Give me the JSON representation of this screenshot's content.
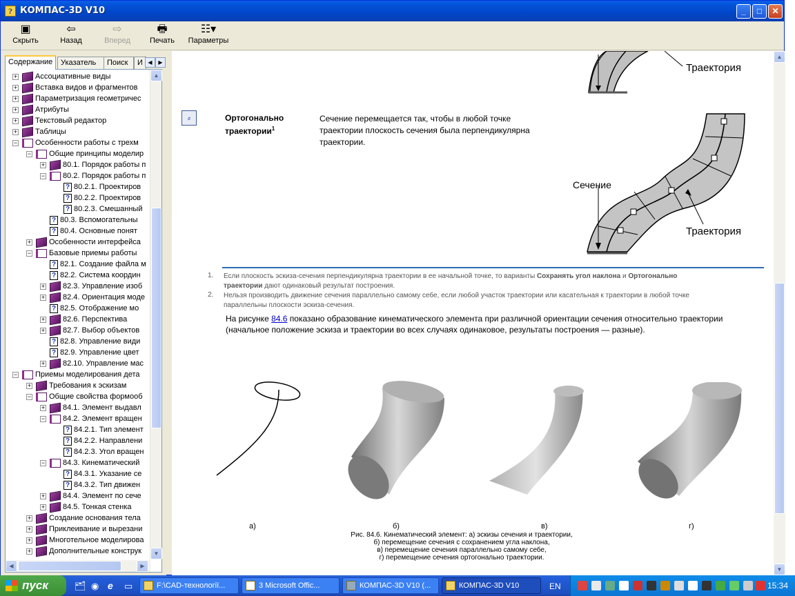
{
  "window": {
    "title": "КОМПАС-3D V10"
  },
  "toolbar": [
    {
      "label": "Скрыть",
      "icon": "hide-icon",
      "enabled": true
    },
    {
      "label": "Назад",
      "icon": "back-arrow-icon",
      "enabled": true
    },
    {
      "label": "Вперед",
      "icon": "forward-arrow-icon",
      "enabled": false
    },
    {
      "label": "Печать",
      "icon": "printer-icon",
      "enabled": true
    },
    {
      "label": "Параметры",
      "icon": "options-icon",
      "enabled": true
    }
  ],
  "tabs": [
    "Содержание",
    "Указатель",
    "Поиск",
    "И"
  ],
  "tree": [
    {
      "label": "Ассоциативные виды",
      "level": 0,
      "type": "book",
      "pm": "+"
    },
    {
      "label": "Вставка видов и фрагментов",
      "level": 0,
      "type": "book",
      "pm": "+"
    },
    {
      "label": "Параметризация геометричес",
      "level": 0,
      "type": "book",
      "pm": "+"
    },
    {
      "label": "Атрибуты",
      "level": 0,
      "type": "book",
      "pm": "+"
    },
    {
      "label": "Текстовый редактор",
      "level": 0,
      "type": "book",
      "pm": "+"
    },
    {
      "label": "Таблицы",
      "level": 0,
      "type": "book",
      "pm": "+"
    },
    {
      "label": "Особенности работы с трехм",
      "level": 0,
      "type": "open",
      "pm": "-"
    },
    {
      "label": "Общие принципы моделир",
      "level": 1,
      "type": "open",
      "pm": "-"
    },
    {
      "label": "80.1. Порядок работы п",
      "level": 2,
      "type": "book",
      "pm": "+"
    },
    {
      "label": "80.2. Порядок работы п",
      "level": 2,
      "type": "open",
      "pm": "-"
    },
    {
      "label": "80.2.1. Проектиров",
      "level": 3,
      "type": "page",
      "pm": ""
    },
    {
      "label": "80.2.2. Проектиров",
      "level": 3,
      "type": "page",
      "pm": ""
    },
    {
      "label": "80.2.3. Смешанный",
      "level": 3,
      "type": "page",
      "pm": ""
    },
    {
      "label": "80.3. Вспомогательны",
      "level": 2,
      "type": "page",
      "pm": ""
    },
    {
      "label": "80.4. Основные понят",
      "level": 2,
      "type": "page",
      "pm": ""
    },
    {
      "label": "Особенности интерфейса",
      "level": 1,
      "type": "book",
      "pm": "+"
    },
    {
      "label": "Базовые приемы работы",
      "level": 1,
      "type": "open",
      "pm": "-"
    },
    {
      "label": "82.1. Создание файла м",
      "level": 2,
      "type": "page",
      "pm": ""
    },
    {
      "label": "82.2. Система координ",
      "level": 2,
      "type": "page",
      "pm": ""
    },
    {
      "label": "82.3. Управление изоб",
      "level": 2,
      "type": "book",
      "pm": "+"
    },
    {
      "label": "82.4. Ориентация моде",
      "level": 2,
      "type": "book",
      "pm": "+"
    },
    {
      "label": "82.5. Отображение мо",
      "level": 2,
      "type": "page",
      "pm": ""
    },
    {
      "label": "82.6. Перспектива",
      "level": 2,
      "type": "book",
      "pm": "+"
    },
    {
      "label": "82.7. Выбор объектов",
      "level": 2,
      "type": "book",
      "pm": "+"
    },
    {
      "label": "82.8. Управление види",
      "level": 2,
      "type": "page",
      "pm": ""
    },
    {
      "label": "82.9. Управление цвет",
      "level": 2,
      "type": "page",
      "pm": ""
    },
    {
      "label": "82.10. Управление мас",
      "level": 2,
      "type": "book",
      "pm": "+"
    },
    {
      "label": "Приемы моделирования дета",
      "level": 0,
      "type": "open",
      "pm": "-"
    },
    {
      "label": "Требования к эскизам",
      "level": 1,
      "type": "book",
      "pm": "+"
    },
    {
      "label": "Общие свойства формооб",
      "level": 1,
      "type": "open",
      "pm": "-"
    },
    {
      "label": "84.1. Элемент выдавл",
      "level": 2,
      "type": "book",
      "pm": "+"
    },
    {
      "label": "84.2. Элемент вращен",
      "level": 2,
      "type": "open",
      "pm": "-"
    },
    {
      "label": "84.2.1. Тип элемент",
      "level": 3,
      "type": "page",
      "pm": ""
    },
    {
      "label": "84.2.2. Направлени",
      "level": 3,
      "type": "page",
      "pm": ""
    },
    {
      "label": "84.2.3. Угол вращен",
      "level": 3,
      "type": "page",
      "pm": ""
    },
    {
      "label": "84.3. Кинематический",
      "level": 2,
      "type": "open",
      "pm": "-"
    },
    {
      "label": "84.3.1. Указание се",
      "level": 3,
      "type": "page",
      "pm": ""
    },
    {
      "label": "84.3.2. Тип движен",
      "level": 3,
      "type": "page",
      "pm": ""
    },
    {
      "label": "84.4. Элемент по сече",
      "level": 2,
      "type": "book",
      "pm": "+"
    },
    {
      "label": "84.5. Тонкая стенка",
      "level": 2,
      "type": "book",
      "pm": "+"
    },
    {
      "label": "Создание основания тела",
      "level": 1,
      "type": "book",
      "pm": "+"
    },
    {
      "label": "Приклеивание и вырезани",
      "level": 1,
      "type": "book",
      "pm": "+"
    },
    {
      "label": "Многотельное моделирова",
      "level": 1,
      "type": "book",
      "pm": "+"
    },
    {
      "label": "Дополнительные конструк",
      "level": 1,
      "type": "book",
      "pm": "+"
    }
  ],
  "content": {
    "top_label": "Траектория",
    "option_title": "Ортогонально траектории",
    "option_title_line1": "Ортогонально",
    "option_title_line2": "траектории",
    "footnote_mark": "1",
    "option_desc_line1": "Сечение перемещается так, чтобы в любой точке",
    "option_desc_line2": "траектории плоскость сечения была перпендикулярна",
    "option_desc_line3": "траектории.",
    "label_section": "Сечение",
    "label_trajectory": "Траектория",
    "notes": [
      {
        "num": "1.",
        "line1_pre": "Если плоскость эскиза-сечения перпендикулярна траектории в ее начальной точке, то варианты ",
        "bold1": "Сохранять угол наклона",
        "mid": " и ",
        "bold2": "Ортогонально",
        "line2_bold": "траектории",
        "line2_rest": " дают одинаковый результат построения."
      },
      {
        "num": "2.",
        "line1": "Нельзя производить движение сечения параллельно самому себе, если любой участок траектории или касательная к траектории в любой точке",
        "line2": "параллельны плоскости эскиза-сечения."
      }
    ],
    "para_pre": "На рисунке ",
    "para_link": "84.6",
    "para_post": " показано образование кинематического элемента при различной ориентации сечения относительно траектории",
    "para_line2": "(начальное положение эскиза и траектории во всех случаях одинаковое, результаты построения — разные).",
    "figure_labels": [
      "а)",
      "б)",
      "в)",
      "г)"
    ],
    "caption": [
      "Рис. 84.6. Кинематический элемент: а) эскизы сечения и траектории,",
      "б) перемещение сечения с сохранением угла наклона,",
      "в) перемещение сечения параллельно самому себе,",
      "г) перемещение сечения ортогонально траектории."
    ]
  },
  "taskbar": {
    "start": "пуск",
    "tasks": [
      "F:\\CAD-технології...",
      "3 Microsoft Offic...",
      "КОМПАС-3D V10 (...",
      "КОМПАС-3D V10"
    ],
    "lang": "EN",
    "clock": "15:34"
  },
  "colors": {
    "rule": "#2a6ab4",
    "link": "#0000cc",
    "title_bar": "#0453d9"
  }
}
